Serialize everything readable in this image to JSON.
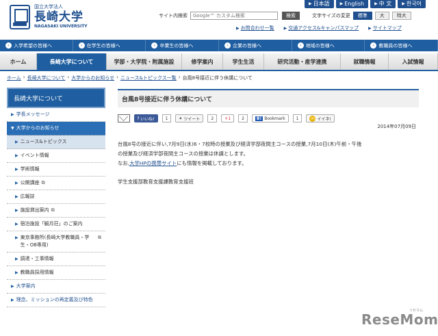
{
  "header": {
    "logo_sub": "国立大学法人",
    "logo_main": "長崎大学",
    "logo_en": "NAGASAKI UNIVERSITY",
    "languages": [
      "日本語",
      "English",
      "中 文",
      "한국어"
    ],
    "search_label": "サイト内検索",
    "search_placeholder": "Google™ カスタム検索",
    "search_button": "検索",
    "fontsize_label": "文字サイズの変更",
    "fontsize_options": [
      "標準",
      "大",
      "特大"
    ],
    "util_links": [
      "お問合わせ一覧",
      "交通アクセス&キャンパスマップ",
      "サイトマップ"
    ]
  },
  "audience_nav": [
    "入学希望の皆様へ",
    "在学生の皆様へ",
    "卒業生の皆様へ",
    "企業の皆様へ",
    "地域の皆様へ",
    "教職員の皆様へ"
  ],
  "main_nav": [
    "ホーム",
    "長崎大学について",
    "学部・大学院・附属施設",
    "修学案内",
    "学生生活",
    "研究活動・産学連携",
    "就職情報",
    "入試情報"
  ],
  "breadcrumb": [
    "ホーム",
    "長崎大学について",
    "大学からのお知らせ",
    "ニュース&トピックス一覧",
    "台風8号接近に伴う休講について"
  ],
  "sidebar": {
    "title": "長崎大学について",
    "items": [
      {
        "label": "学長メッセージ"
      },
      {
        "label": "大学からのお知らせ"
      },
      {
        "label": "ニュース&トピックス"
      },
      {
        "label": "イベント情報"
      },
      {
        "label": "学術情報"
      },
      {
        "label": "公開講座"
      },
      {
        "label": "広報誌"
      },
      {
        "label": "施設貸出案内"
      },
      {
        "label": "宿泊施設「観月荘」のご案内"
      },
      {
        "label": "東京事務所(長崎大学教職員・学生・OB専用)"
      },
      {
        "label": "調達・工事情報"
      },
      {
        "label": "教職員採用情報"
      },
      {
        "label": "大学案内"
      },
      {
        "label": "理念、ミッションの再定義及び特色"
      }
    ]
  },
  "content": {
    "title": "台風8号接近に伴う休講について",
    "social": {
      "fb_label": "いいね!",
      "fb_count": "1",
      "tweet_label": "ツイート",
      "tweet_count": "2",
      "gplus_label": "+1",
      "gplus_count": "2",
      "bm_logo": "B!",
      "bm_label": "Bookmark",
      "bm_count": "1",
      "mixi_logo": "m",
      "mixi_label": "イイネ!"
    },
    "date": "2014年07月09日",
    "body_line1": "台風8号の接近に伴い,7月9日(水)6・7校時の授業及び経済学部夜間主コースの授業,7月10日(木)午前・午後",
    "body_line2": "の授業及び経済学部夜間主コースの授業は休講とします。",
    "body_line3_pre": "なお,",
    "body_line3_link": "大学HPの携帯サイト",
    "body_line3_post": "にも情報を掲載しております。",
    "signature": "学生支援部教育支援課教育支援班"
  },
  "watermark": {
    "main": "ReseMom",
    "sub": "リセマム"
  },
  "colors": {
    "primary": "#1f5ea0",
    "dark": "#1f4f8f",
    "highlight": "#2a6eb5"
  }
}
